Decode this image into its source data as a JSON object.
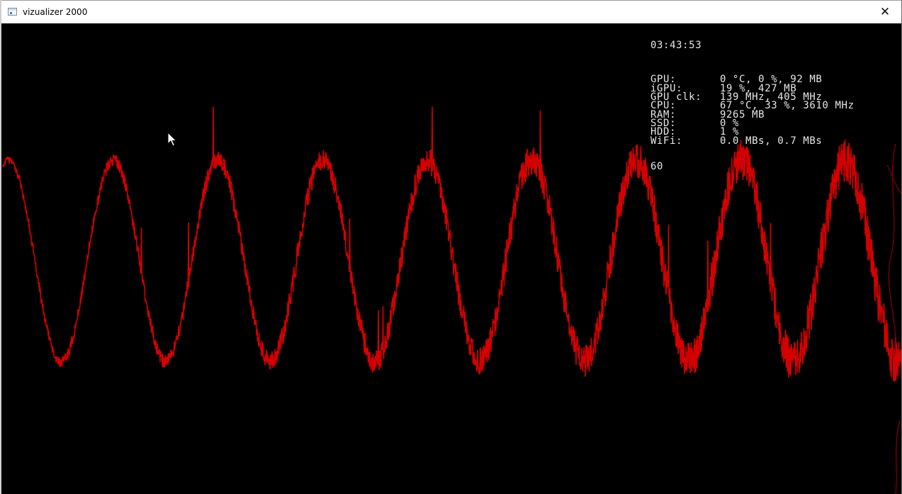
{
  "window": {
    "title": "vizualizer 2000",
    "close_glyph": "✕",
    "icon": "app-window-icon"
  },
  "stats": {
    "clock": "03:43:53",
    "rows": [
      {
        "key": "GPU:",
        "value": "0 °C, 0 %, 92 MB"
      },
      {
        "key": "iGPU:",
        "value": "19 %, 427 MB"
      },
      {
        "key": "GPU clk:",
        "value": "139 MHz, 405 MHz"
      },
      {
        "key": "CPU:",
        "value": "67 °C, 33 %, 3610 MHz"
      },
      {
        "key": "RAM:",
        "value": "9265 MB"
      },
      {
        "key": "SSD:",
        "value": "0 %"
      },
      {
        "key": "HDD:",
        "value": "1 %"
      },
      {
        "key": "WiFi:",
        "value": "0.0 MBs, 0.7 MBs"
      }
    ],
    "fps": "60"
  },
  "visualizer": {
    "wave_color": "#d40000",
    "background": "#000000",
    "cycles": 8.6,
    "amplitude": 0.82,
    "noise_level": "increasing toward the right"
  },
  "cursor_icon": "mouse-pointer-icon"
}
